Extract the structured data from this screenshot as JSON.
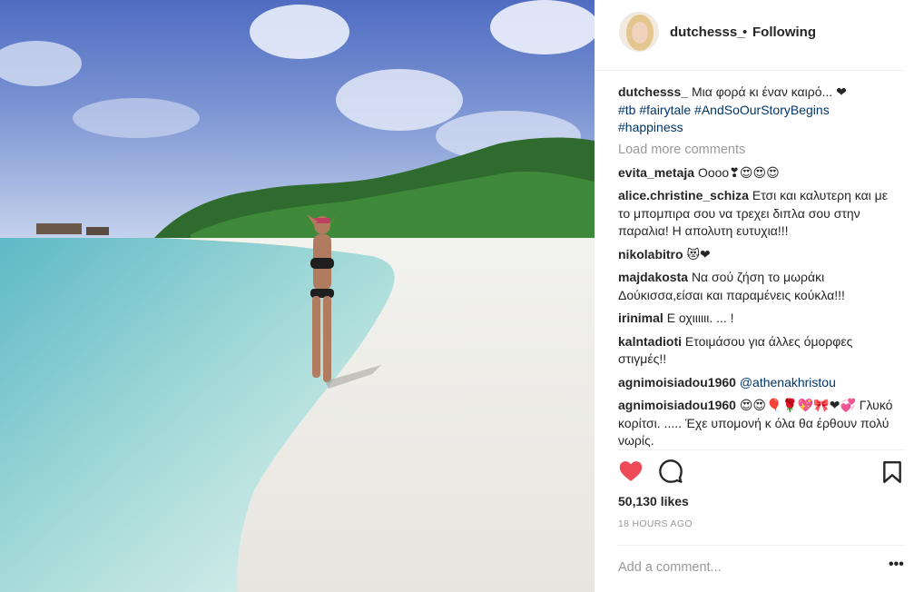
{
  "post": {
    "username": "dutchesss_",
    "separator": "•",
    "follow_status": "Following",
    "caption": {
      "username": "dutchesss_",
      "text": "Μια φορά κι έναν καιρό... ❤",
      "tags_line1": "#tb #fairytale #AndSoOurStoryBegins",
      "tags_line2": "#happiness"
    },
    "load_more": "Load more comments",
    "comments": [
      {
        "user": "evita_metaja",
        "text": "Οοοο❣😍😍😍"
      },
      {
        "user": "alice.christine_schiza",
        "text": "Ετσι και καλυτερη και με το μπομπιρα σου να τρεχει διπλα σου στην παραλια! Η απολυτη ευτυχια!!!"
      },
      {
        "user": "nikolabitro",
        "text": "😻❤"
      },
      {
        "user": "majdakosta",
        "text": "Να σού ζήση το μωράκι Δούκισσα,είσαι και παραμένεις κούκλα!!!"
      },
      {
        "user": "irinimal",
        "text": "Ε οχιιιιιι. ... !"
      },
      {
        "user": "kalntadioti",
        "text": "Ετοιμάσου για άλλες όμορφες στιγμές!!"
      },
      {
        "user": "agnimoisiadou1960",
        "text": "@athenakhristou"
      },
      {
        "user": "agnimoisiadou1960",
        "text": "😍😍🎈🌹💖🎀❤💞 Γλυκό κορίτσι. ..... Έχε υπομονή κ όλα θα έρθουν πολύ νωρίς."
      }
    ],
    "likes": "50,130 likes",
    "time": "18 HOURS AGO",
    "add_comment_placeholder": "Add a comment...",
    "more_options": "•••"
  },
  "icons": {
    "like": "heart-filled-icon",
    "comment": "comment-bubble-icon",
    "save": "bookmark-icon"
  },
  "colors": {
    "heart": "#ed4956",
    "hashtag": "#003569",
    "muted": "#999999"
  }
}
